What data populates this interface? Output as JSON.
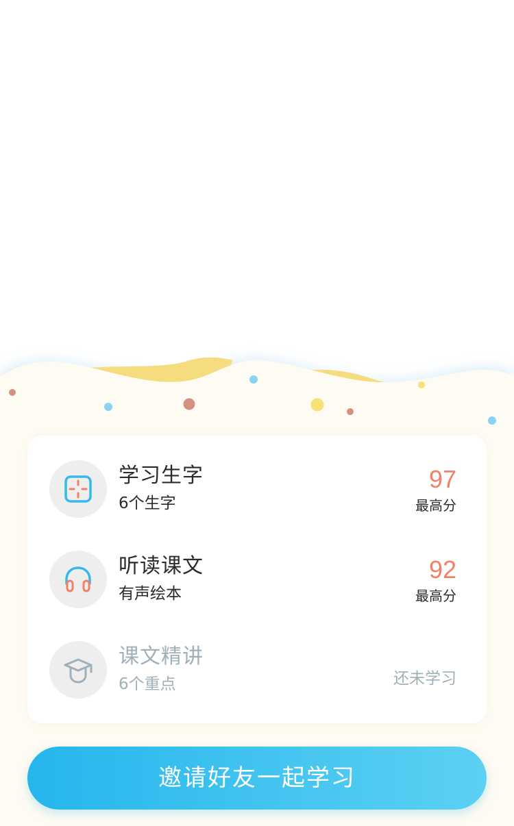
{
  "colors": {
    "background_cream": "#fefbf2",
    "wave_yellow": "#f5dc7e",
    "score_accent": "#f47f67",
    "button_start": "#25b6ec",
    "button_end": "#5dd0f3",
    "disabled_text": "#9fb0ba"
  },
  "tasks": [
    {
      "icon": "character-box-icon",
      "title": "学习生字",
      "subtitle": "6个生字",
      "score": "97",
      "score_label": "最高分"
    },
    {
      "icon": "headphones-icon",
      "title": "听读课文",
      "subtitle": "有声绘本",
      "score": "92",
      "score_label": "最高分"
    },
    {
      "icon": "graduation-cap-icon",
      "title": "课文精讲",
      "subtitle": "6个重点",
      "status": "还未学习"
    }
  ],
  "invite_button": {
    "label": "邀请好友一起学习"
  }
}
